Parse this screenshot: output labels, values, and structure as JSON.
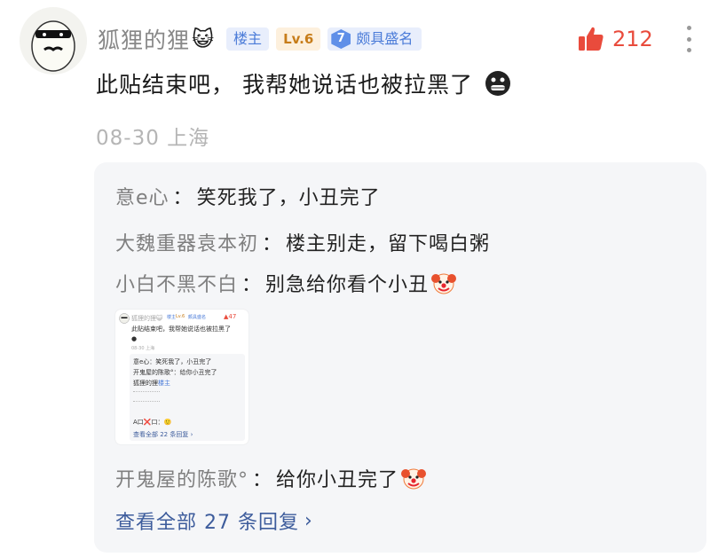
{
  "post": {
    "username": "狐狸的狸",
    "name_emoji": "😺",
    "badge_host": "楼主",
    "badge_level": "Lv.6",
    "badge_rep_level": "7",
    "badge_rep": "颇具盛名",
    "like_count": "212",
    "content": "此贴结束吧， 我帮她说话也被拉黑了",
    "date": "08-30",
    "location": "上海"
  },
  "replies": [
    {
      "user": "意e心",
      "sep": "：",
      "text": "笑死我了，小丑完了",
      "emoji": ""
    },
    {
      "user": "大魏重器袁本初",
      "sep": "：",
      "text": "楼主别走，留下喝白粥",
      "emoji": ""
    },
    {
      "user": "小白不黑不白",
      "sep": "：",
      "text": "别急给你看个小丑",
      "emoji": "clown"
    },
    {
      "user": "开鬼屋的陈歌°",
      "sep": "：",
      "text": "给你小丑完了",
      "emoji": "clown"
    }
  ],
  "view_all": "查看全部 27 条回复",
  "thumbnail": {
    "username": "狐狸的狸",
    "name_emoji": "😺",
    "badge_host": "楼主",
    "badge_level": "Lv.6",
    "badge_rep": "颇具盛名",
    "like_count": "47",
    "content": "此贴结束吧，我帮她说话也被拉黑了",
    "meta": "08-30 上海",
    "r1": "意e心：笑死我了，小丑完了",
    "r2": "开鬼屋的陈歌°：给你小丑完了",
    "r3_user": "狐狸的狸",
    "r3_badge": "楼主",
    "r4": "A口❌口：🙂",
    "view_all": "查看全部 22 条回复 ›"
  },
  "colors": {
    "accent_blue": "#4a7bd8",
    "like_red": "#e94b3c",
    "reply_bg": "#f5f6f8",
    "link": "#3d5c9c"
  }
}
